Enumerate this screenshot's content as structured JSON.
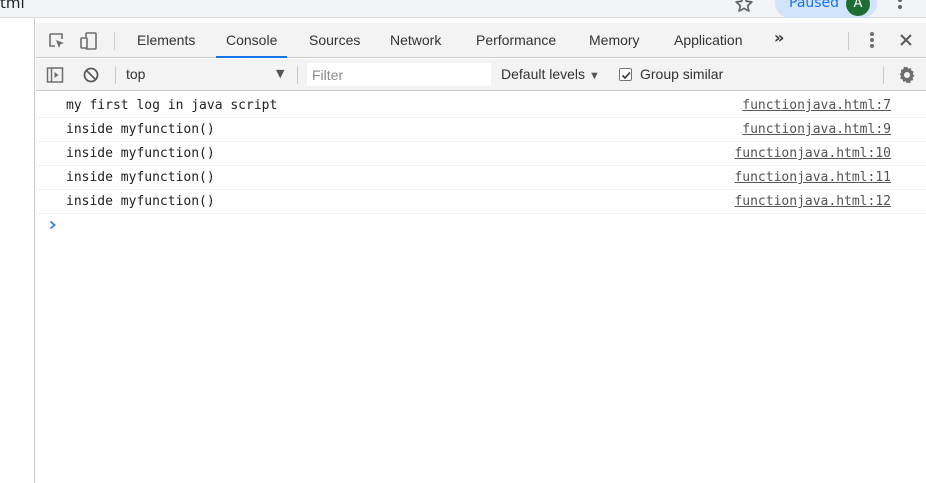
{
  "browser": {
    "url_fragment": "tml",
    "paused_label": "Paused",
    "avatar_letter": "A"
  },
  "devtools": {
    "tabs": [
      "Elements",
      "Console",
      "Sources",
      "Network",
      "Performance",
      "Memory",
      "Application"
    ],
    "active_tab": "Console",
    "more_tabs": "»"
  },
  "console_toolbar": {
    "context": "top",
    "filter_placeholder": "Filter",
    "levels_label": "Default levels",
    "group_similar_label": "Group similar",
    "group_similar_checked": true
  },
  "messages": [
    {
      "text": "my first log in java script",
      "source": "functionjava.html:7"
    },
    {
      "text": "inside myfunction()",
      "source": "functionjava.html:9"
    },
    {
      "text": "inside myfunction()",
      "source": "functionjava.html:10"
    },
    {
      "text": "inside myfunction()",
      "source": "functionjava.html:11"
    },
    {
      "text": "inside myfunction()",
      "source": "functionjava.html:12"
    }
  ],
  "colors": {
    "accent": "#1a73e8",
    "toolbar_bg": "#f3f3f3",
    "prompt_arrow": "#367cf1"
  }
}
